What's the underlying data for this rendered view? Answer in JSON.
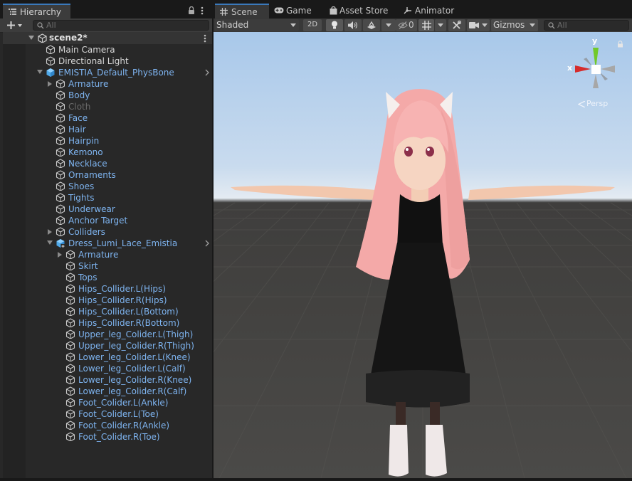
{
  "hierarchy": {
    "tab_title": "Hierarchy",
    "search_placeholder": "All",
    "scene_name": "scene2*",
    "items": [
      {
        "label": "Main Camera",
        "indent": 1,
        "arrow": "none",
        "color": "white",
        "icon": "gameobject"
      },
      {
        "label": "Directional Light",
        "indent": 1,
        "arrow": "none",
        "color": "white",
        "icon": "gameobject"
      },
      {
        "label": "EMISTIA_Default_PhysBone",
        "indent": 1,
        "arrow": "down",
        "color": "blue",
        "icon": "prefab",
        "chevron": true
      },
      {
        "label": "Armature",
        "indent": 2,
        "arrow": "right",
        "color": "blue",
        "icon": "gameobject"
      },
      {
        "label": "Body",
        "indent": 2,
        "arrow": "none",
        "color": "blue",
        "icon": "gameobject"
      },
      {
        "label": "Cloth",
        "indent": 2,
        "arrow": "none",
        "color": "grey",
        "icon": "gameobject"
      },
      {
        "label": "Face",
        "indent": 2,
        "arrow": "none",
        "color": "blue",
        "icon": "gameobject"
      },
      {
        "label": "Hair",
        "indent": 2,
        "arrow": "none",
        "color": "blue",
        "icon": "gameobject"
      },
      {
        "label": "Hairpin",
        "indent": 2,
        "arrow": "none",
        "color": "blue",
        "icon": "gameobject"
      },
      {
        "label": "Kemono",
        "indent": 2,
        "arrow": "none",
        "color": "blue",
        "icon": "gameobject"
      },
      {
        "label": "Necklace",
        "indent": 2,
        "arrow": "none",
        "color": "blue",
        "icon": "gameobject"
      },
      {
        "label": "Ornaments",
        "indent": 2,
        "arrow": "none",
        "color": "blue",
        "icon": "gameobject"
      },
      {
        "label": "Shoes",
        "indent": 2,
        "arrow": "none",
        "color": "blue",
        "icon": "gameobject"
      },
      {
        "label": "Tights",
        "indent": 2,
        "arrow": "none",
        "color": "blue",
        "icon": "gameobject"
      },
      {
        "label": "Underwear",
        "indent": 2,
        "arrow": "none",
        "color": "blue",
        "icon": "gameobject"
      },
      {
        "label": "Anchor Target",
        "indent": 2,
        "arrow": "none",
        "color": "blue",
        "icon": "gameobject"
      },
      {
        "label": "Colliders",
        "indent": 2,
        "arrow": "right",
        "color": "blue",
        "icon": "gameobject"
      },
      {
        "label": "Dress_Lumi_Lace_Emistia",
        "indent": 2,
        "arrow": "down",
        "color": "blue",
        "icon": "prefab-variant",
        "chevron": true
      },
      {
        "label": "Armature",
        "indent": 3,
        "arrow": "right",
        "color": "blue",
        "icon": "gameobject"
      },
      {
        "label": "Skirt",
        "indent": 3,
        "arrow": "none",
        "color": "blue",
        "icon": "gameobject"
      },
      {
        "label": "Tops",
        "indent": 3,
        "arrow": "none",
        "color": "blue",
        "icon": "gameobject"
      },
      {
        "label": "Hips_Collider.L(Hips)",
        "indent": 3,
        "arrow": "none",
        "color": "blue",
        "icon": "gameobject"
      },
      {
        "label": "Hips_Collider.R(Hips)",
        "indent": 3,
        "arrow": "none",
        "color": "blue",
        "icon": "gameobject"
      },
      {
        "label": "Hips_Collider.L(Bottom)",
        "indent": 3,
        "arrow": "none",
        "color": "blue",
        "icon": "gameobject"
      },
      {
        "label": "Hips_Collider.R(Bottom)",
        "indent": 3,
        "arrow": "none",
        "color": "blue",
        "icon": "gameobject"
      },
      {
        "label": "Upper_leg_Colider.L(Thigh)",
        "indent": 3,
        "arrow": "none",
        "color": "blue",
        "icon": "gameobject"
      },
      {
        "label": "Upper_leg_Colider.R(Thigh)",
        "indent": 3,
        "arrow": "none",
        "color": "blue",
        "icon": "gameobject"
      },
      {
        "label": "Lower_leg_Colider.L(Knee)",
        "indent": 3,
        "arrow": "none",
        "color": "blue",
        "icon": "gameobject"
      },
      {
        "label": "Lower_leg_Colider.L(Calf)",
        "indent": 3,
        "arrow": "none",
        "color": "blue",
        "icon": "gameobject"
      },
      {
        "label": "Lower_leg_Colider.R(Knee)",
        "indent": 3,
        "arrow": "none",
        "color": "blue",
        "icon": "gameobject"
      },
      {
        "label": "Lower_leg_Colider.R(Calf)",
        "indent": 3,
        "arrow": "none",
        "color": "blue",
        "icon": "gameobject"
      },
      {
        "label": "Foot_Colider.L(Ankle)",
        "indent": 3,
        "arrow": "none",
        "color": "blue",
        "icon": "gameobject"
      },
      {
        "label": "Foot_Colider.L(Toe)",
        "indent": 3,
        "arrow": "none",
        "color": "blue",
        "icon": "gameobject"
      },
      {
        "label": "Foot_Colider.R(Ankle)",
        "indent": 3,
        "arrow": "none",
        "color": "blue",
        "icon": "gameobject"
      },
      {
        "label": "Foot_Colider.R(Toe)",
        "indent": 3,
        "arrow": "none",
        "color": "blue",
        "icon": "gameobject"
      }
    ]
  },
  "scene_tabs": {
    "scene": "Scene",
    "game": "Game",
    "asset_store": "Asset Store",
    "animator": "Animator"
  },
  "scene_toolbar": {
    "shading_mode": "Shaded",
    "mode_2d": "2D",
    "hidden_count": "0",
    "gizmos": "Gizmos",
    "search_placeholder": "All"
  },
  "gizmo": {
    "x_label": "x",
    "y_label": "y",
    "projection": "Persp"
  },
  "colors": {
    "prefab_text": "#7eb4f0",
    "normal_text": "#d8d8d8",
    "inactive_text": "#6a6a6a",
    "axis_x": "#d62c2c",
    "axis_y": "#71c92a",
    "panel_bg": "#282828",
    "tab_accent": "#3a79bb"
  }
}
